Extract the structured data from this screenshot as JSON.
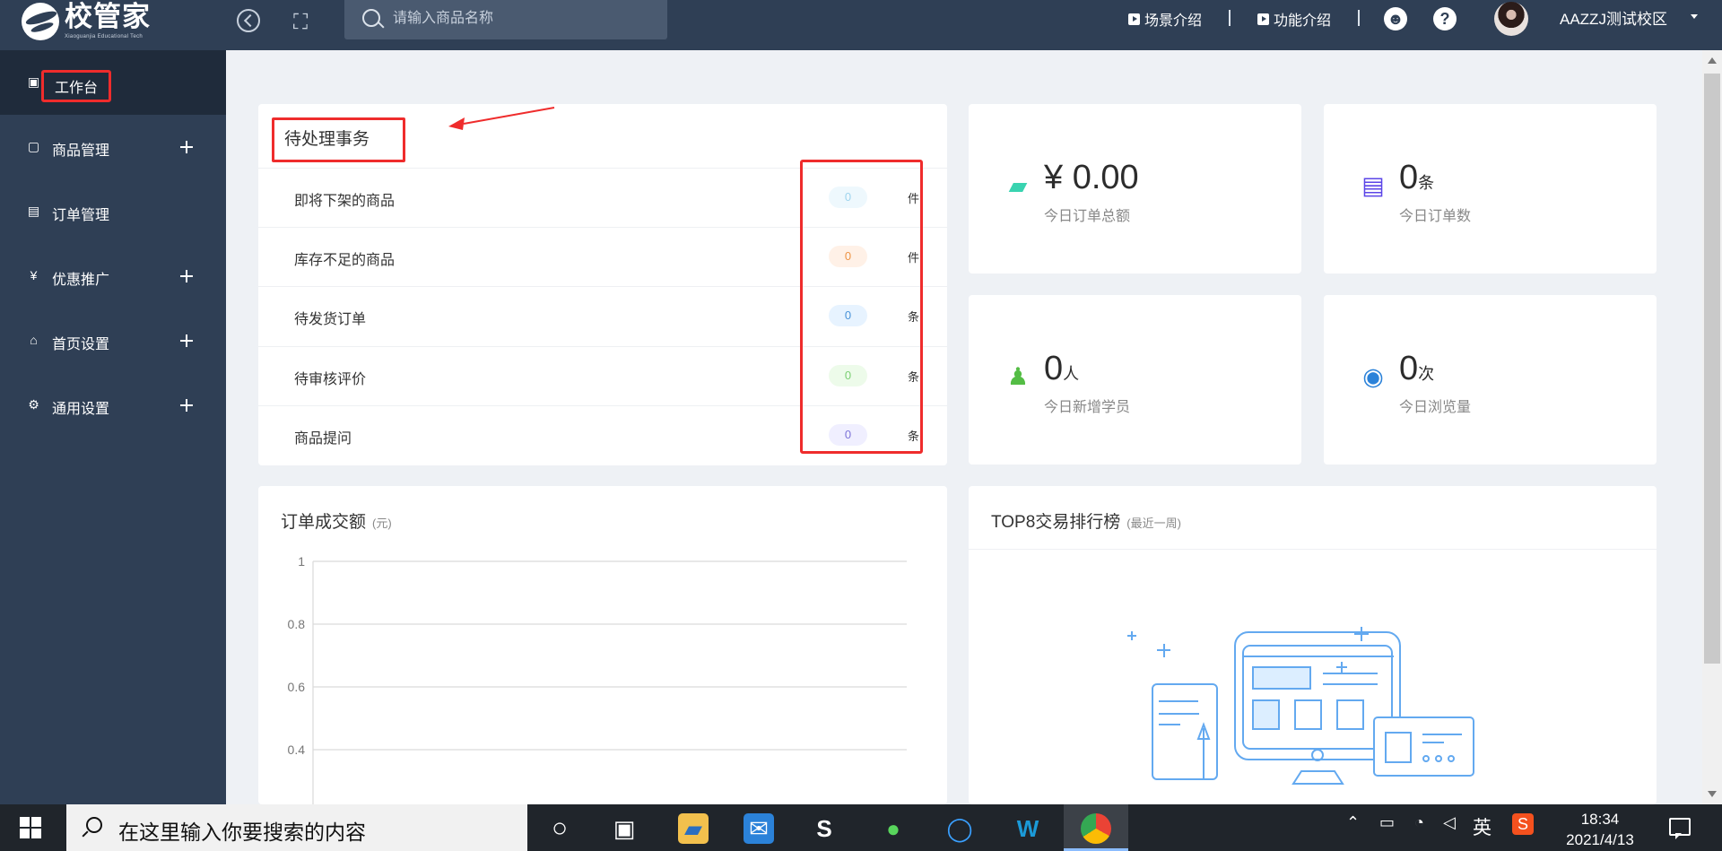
{
  "app": {
    "logo_title": "校管家",
    "logo_subtitle": "Xiaoguanjia Educational Tech",
    "search_placeholder": "请输入商品名称",
    "links": [
      "场景介绍",
      "功能介绍"
    ],
    "campus": "AAZZJ测试校区"
  },
  "sidebar": {
    "items": [
      {
        "label": "工作台",
        "icon": "monitor-icon",
        "active": true
      },
      {
        "label": "商品管理",
        "icon": "bag-icon",
        "expandable": true
      },
      {
        "label": "订单管理",
        "icon": "document-icon",
        "expandable": false
      },
      {
        "label": "优惠推广",
        "icon": "coupon-icon",
        "expandable": true
      },
      {
        "label": "首页设置",
        "icon": "home-icon",
        "expandable": true
      },
      {
        "label": "通用设置",
        "icon": "gear-icon",
        "expandable": true
      }
    ]
  },
  "pending": {
    "title": "待处理事务",
    "rows": [
      {
        "label": "即将下架的商品",
        "count": "0",
        "unit": "件",
        "bg": "#eef8fd",
        "color": "#9fd4ee"
      },
      {
        "label": "库存不足的商品",
        "count": "0",
        "unit": "件",
        "bg": "#fff1e7",
        "color": "#ee9547"
      },
      {
        "label": "待发货订单",
        "count": "0",
        "unit": "条",
        "bg": "#e7f3ff",
        "color": "#4a93d8"
      },
      {
        "label": "待审核评价",
        "count": "0",
        "unit": "条",
        "bg": "#edfbea",
        "color": "#7bcf74"
      },
      {
        "label": "商品提问",
        "count": "0",
        "unit": "条",
        "bg": "#f0efff",
        "color": "#7d74d8"
      }
    ]
  },
  "stats": [
    {
      "value": "¥ 0.00",
      "unit": "",
      "label": "今日订单总额",
      "icon": "wallet-icon",
      "color": "#39d3b0"
    },
    {
      "value": "0",
      "unit": "条",
      "label": "今日订单数",
      "icon": "clipboard-icon",
      "color": "#5b45e7"
    },
    {
      "value": "0",
      "unit": "人",
      "label": "今日新增学员",
      "icon": "add-user-icon",
      "color": "#54bd45"
    },
    {
      "value": "0",
      "unit": "次",
      "label": "今日浏览量",
      "icon": "eye-icon",
      "color": "#2b82d9"
    }
  ],
  "order_chart": {
    "title": "订单成交额",
    "unit_note": "(元)"
  },
  "rank": {
    "title": "TOP8交易排行榜",
    "note": "(最近一周)"
  },
  "chart_data": {
    "type": "line",
    "title": "订单成交额",
    "ylabel": "(元)",
    "y_ticks": [
      "1",
      "0.8",
      "0.6",
      "0.4"
    ],
    "ylim": [
      0,
      1
    ],
    "grid": true,
    "series": []
  },
  "taskbar": {
    "search": "在这里输入你要搜索的内容",
    "language": "英",
    "time": "18:34",
    "date": "2021/4/13"
  }
}
